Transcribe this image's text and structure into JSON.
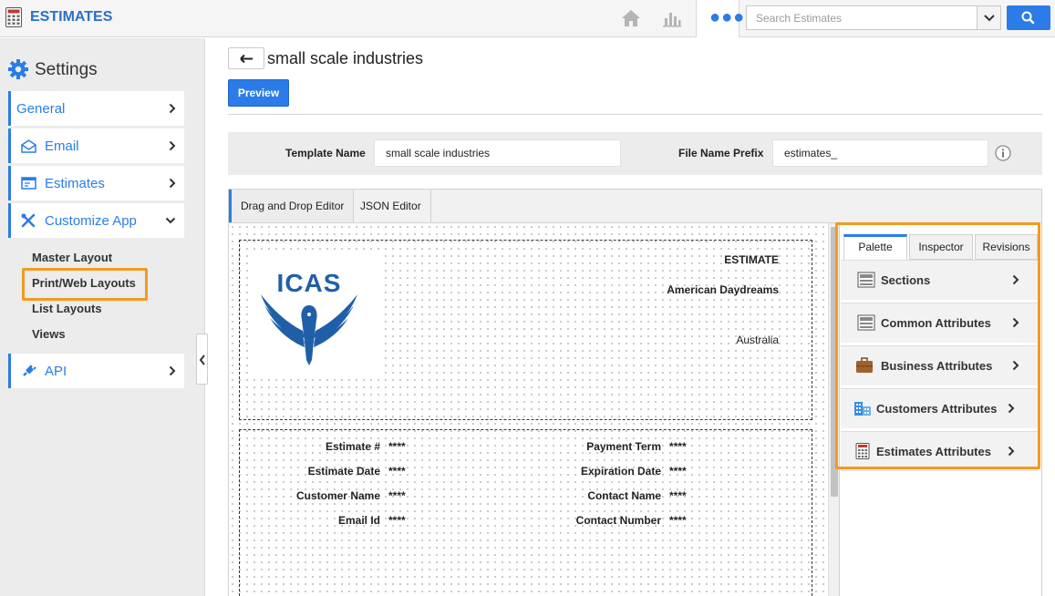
{
  "app": {
    "title": "ESTIMATES"
  },
  "search": {
    "placeholder": "Search Estimates"
  },
  "sidebar": {
    "heading": "Settings",
    "items": [
      {
        "label": "General",
        "icon": "none"
      },
      {
        "label": "Email",
        "icon": "email-icon"
      },
      {
        "label": "Estimates",
        "icon": "estimates-icon"
      },
      {
        "label": "Customize App",
        "icon": "tools-icon"
      },
      {
        "label": "API",
        "icon": "plug-icon"
      }
    ],
    "sub_items": [
      "Master Layout",
      "Print/Web Layouts",
      "List Layouts",
      "Views"
    ]
  },
  "main": {
    "title": "small scale industries",
    "preview_label": "Preview",
    "template_name_label": "Template Name",
    "template_name_value": "small scale industries",
    "file_prefix_label": "File Name Prefix",
    "file_prefix_value": "estimates_",
    "editor_tabs": [
      "Drag and Drop Editor",
      "JSON Editor"
    ]
  },
  "canvas": {
    "header": {
      "title": "ESTIMATE",
      "company": "American Daydreams",
      "country": "Australia",
      "logo_text": "ICAS"
    },
    "fields_left": [
      {
        "label": "Estimate #",
        "value": "****"
      },
      {
        "label": "Estimate Date",
        "value": "****"
      },
      {
        "label": "Customer Name",
        "value": "****"
      },
      {
        "label": "Email Id",
        "value": "****"
      }
    ],
    "fields_right": [
      {
        "label": "Payment Term",
        "value": "****"
      },
      {
        "label": "Expiration Date",
        "value": "****"
      },
      {
        "label": "Contact Name",
        "value": "****"
      },
      {
        "label": "Contact Number",
        "value": "****"
      }
    ]
  },
  "palette": {
    "tabs": [
      "Palette",
      "Inspector",
      "Revisions"
    ],
    "items": [
      {
        "label": "Sections",
        "icon": "sections-icon"
      },
      {
        "label": "Common Attributes",
        "icon": "common-attributes-icon"
      },
      {
        "label": "Business Attributes",
        "icon": "briefcase-icon"
      },
      {
        "label": "Customers Attributes",
        "icon": "building-icon"
      },
      {
        "label": "Estimates Attributes",
        "icon": "calculator-icon"
      }
    ]
  },
  "colors": {
    "accent": "#2b7ce8",
    "highlight": "#f39a1e",
    "logo": "#1f5fa8"
  }
}
